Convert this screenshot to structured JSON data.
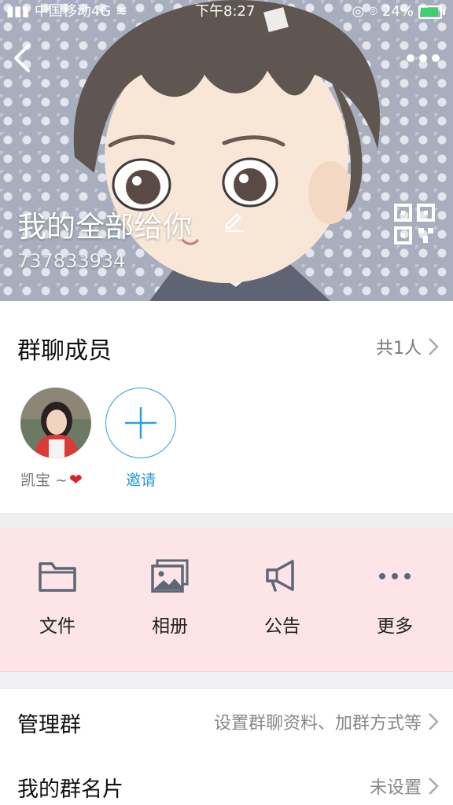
{
  "status_bar": {
    "carrier": "中国移动4G",
    "time": "下午8:27",
    "battery": "24%"
  },
  "header": {
    "group_name": "我的全部给你",
    "group_id": "737833934"
  },
  "members": {
    "title": "群聊成员",
    "count": "共1人",
    "list": [
      {
        "name": "凯宝 ~"
      }
    ],
    "invite_label": "邀请"
  },
  "features": [
    {
      "label": "文件",
      "icon": "folder-icon"
    },
    {
      "label": "相册",
      "icon": "album-icon"
    },
    {
      "label": "公告",
      "icon": "megaphone-icon"
    },
    {
      "label": "更多",
      "icon": "more-dots-icon"
    }
  ],
  "settings": [
    {
      "label": "管理群",
      "value": "设置群聊资料、加群方式等"
    },
    {
      "label": "我的群名片",
      "value": "未设置"
    }
  ],
  "colors": {
    "accent": "#2aa3d8",
    "features_bg": "#fde5e7",
    "icon_gray": "#5d6778"
  }
}
